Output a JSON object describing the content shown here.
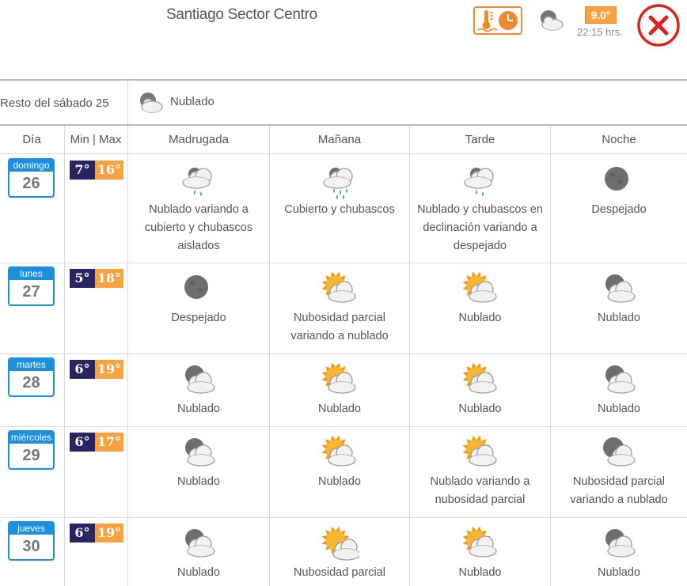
{
  "header": {
    "location": "Santiago Sector Centro",
    "current_temp": "9.0°",
    "current_time": "22:15 hrs.",
    "current_icon": "cloudy-night-icon",
    "close_icon": "close-icon"
  },
  "resto": {
    "label": "Resto del sábado 25",
    "condition": "Nublado",
    "icon": "cloudy-night-icon"
  },
  "columns": {
    "day": "Día",
    "minmax": "Min | Max",
    "madrugada": "Madrugada",
    "manana": "Mañana",
    "tarde": "Tarde",
    "noche": "Noche"
  },
  "days": [
    {
      "name": "domingo",
      "num": "26",
      "min": "7°",
      "max": "16°",
      "periods": [
        {
          "icon": "rain-showers-icon",
          "text": "Nublado variando a cubierto y chubascos aislados"
        },
        {
          "icon": "heavy-showers-icon",
          "text": "Cubierto y chubascos"
        },
        {
          "icon": "rain-showers-icon",
          "text": "Nublado y chubascos en declinación variando a despejado"
        },
        {
          "icon": "clear-night-moon-icon",
          "text": "Despejado"
        }
      ]
    },
    {
      "name": "lunes",
      "num": "27",
      "min": "5°",
      "max": "18°",
      "periods": [
        {
          "icon": "clear-night-moon-icon",
          "text": "Despejado"
        },
        {
          "icon": "partly-cloudy-day-icon",
          "text": "Nubosidad parcial variando a nublado"
        },
        {
          "icon": "partly-cloudy-day-icon",
          "text": "Nublado"
        },
        {
          "icon": "cloudy-night-icon",
          "text": "Nublado"
        }
      ]
    },
    {
      "name": "martes",
      "num": "28",
      "min": "6°",
      "max": "19°",
      "periods": [
        {
          "icon": "cloudy-night-icon",
          "text": "Nublado"
        },
        {
          "icon": "partly-cloudy-day-icon",
          "text": "Nublado"
        },
        {
          "icon": "partly-cloudy-day-icon",
          "text": "Nublado"
        },
        {
          "icon": "cloudy-night-icon",
          "text": "Nublado"
        }
      ]
    },
    {
      "name": "miércoles",
      "num": "29",
      "min": "6°",
      "max": "17°",
      "periods": [
        {
          "icon": "cloudy-night-icon",
          "text": "Nublado"
        },
        {
          "icon": "partly-cloudy-day-icon",
          "text": "Nublado"
        },
        {
          "icon": "partly-cloudy-day-icon",
          "text": "Nublado variando a nubosidad parcial"
        },
        {
          "icon": "partly-cloudy-night-icon",
          "text": "Nubosidad parcial variando a nublado"
        }
      ]
    },
    {
      "name": "jueves",
      "num": "30",
      "min": "6°",
      "max": "19°",
      "periods": [
        {
          "icon": "cloudy-night-icon",
          "text": "Nublado"
        },
        {
          "icon": "sun-partly-cloudy-icon",
          "text": "Nubosidad parcial"
        },
        {
          "icon": "partly-cloudy-day-icon",
          "text": "Nublado"
        },
        {
          "icon": "cloudy-night-icon",
          "text": "Nublado"
        }
      ]
    }
  ],
  "colors": {
    "accent_blue": "#1b8fe0",
    "min_temp_bg": "#2a2463",
    "max_temp_bg": "#f7a23e",
    "close_red": "#e02020",
    "text": "#555555"
  }
}
